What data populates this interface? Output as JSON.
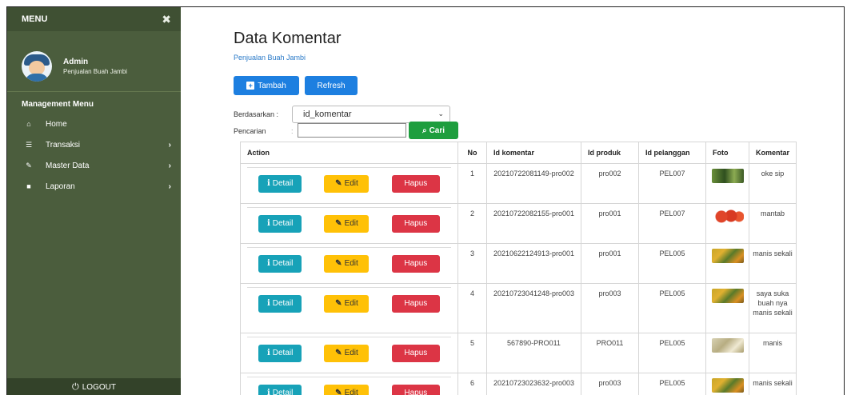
{
  "sidebar": {
    "menu_label": "MENU",
    "close_glyph": "✖",
    "user_name": "Admin",
    "user_sub": "Penjualan Buah Jambi",
    "section_label": "Management Menu",
    "items": [
      {
        "label": "Home",
        "icon": "home-icon",
        "glyph": "⌂"
      },
      {
        "label": "Transaksi",
        "icon": "cart-icon",
        "glyph": "☰",
        "chevron": "›"
      },
      {
        "label": "Master Data",
        "icon": "edit-icon",
        "glyph": "✎",
        "chevron": "›"
      },
      {
        "label": "Laporan",
        "icon": "document-icon",
        "glyph": "■",
        "chevron": "›"
      }
    ],
    "logout_label": "LOGOUT",
    "logout_glyph": "⏻",
    "bg_color": "#4b5d3d"
  },
  "page": {
    "title": "Data Komentar",
    "subtitle": "Penjualan Buah Jambi"
  },
  "toolbar": {
    "tambah_label": "Tambah",
    "refresh_label": "Refresh"
  },
  "filter": {
    "by_label": "Berdasarkan :",
    "selected": "id_komentar",
    "search_label": "Pencarian",
    "search_colon": ":",
    "search_value": "",
    "search_button": "Cari",
    "search_glyph": "⌕"
  },
  "table": {
    "headers": [
      "Action",
      "No",
      "Id komentar",
      "Id produk",
      "Id pelanggan",
      "Foto",
      "Komentar"
    ],
    "action_labels": {
      "detail": "Detail",
      "edit": "Edit",
      "hapus": "Hapus",
      "detail_glyph": "i",
      "edit_glyph": "✎"
    },
    "rows": [
      {
        "no": "1",
        "id_komentar": "20210722081149-pro002",
        "id_produk": "pro002",
        "id_pelanggan": "PEL007",
        "foto": "green",
        "komentar": "oke sip"
      },
      {
        "no": "2",
        "id_komentar": "20210722082155-pro001",
        "id_produk": "pro001",
        "id_pelanggan": "PEL007",
        "foto": "red",
        "komentar": "mantab"
      },
      {
        "no": "3",
        "id_komentar": "20210622124913-pro001",
        "id_produk": "pro001",
        "id_pelanggan": "PEL005",
        "foto": "mixed",
        "komentar": "manis sekali"
      },
      {
        "no": "4",
        "id_komentar": "20210723041248-pro003",
        "id_produk": "pro003",
        "id_pelanggan": "PEL005",
        "foto": "mixed",
        "komentar": "saya suka buah nya manis sekali"
      },
      {
        "no": "5",
        "id_komentar": "567890-PRO011",
        "id_produk": "PRO011",
        "id_pelanggan": "PEL005",
        "foto": "pale",
        "komentar": "manis"
      },
      {
        "no": "6",
        "id_komentar": "20210723023632-pro003",
        "id_produk": "pro003",
        "id_pelanggan": "PEL005",
        "foto": "mixed",
        "komentar": "manis sekali"
      }
    ]
  },
  "colors": {
    "primary": "#1d7fe0",
    "success": "#1e9e3e",
    "info": "#17a2b8",
    "warning": "#ffc107",
    "danger": "#dc3545"
  }
}
